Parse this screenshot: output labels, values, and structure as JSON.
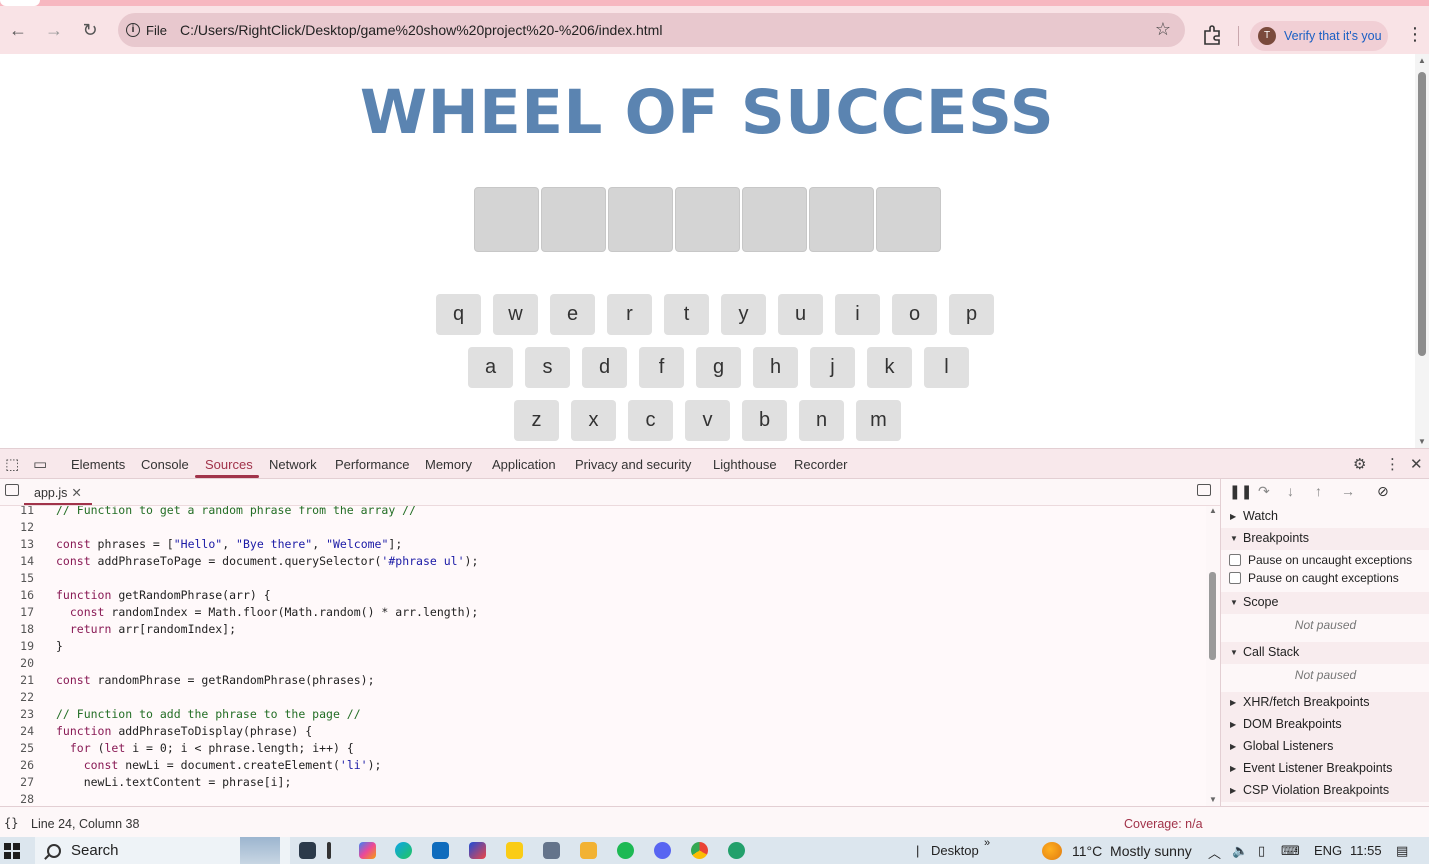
{
  "browser": {
    "site_chip_label": "File",
    "url": "C:/Users/RightClick/Desktop/game%20show%20project%20-%206/index.html",
    "profile_initial": "T",
    "profile_label": "Verify that it's you"
  },
  "game": {
    "title": "WHEEL OF SUCCESS",
    "phrase_tile_count": 7,
    "keyboard_rows": [
      [
        "q",
        "w",
        "e",
        "r",
        "t",
        "y",
        "u",
        "i",
        "o",
        "p"
      ],
      [
        "a",
        "s",
        "d",
        "f",
        "g",
        "h",
        "j",
        "k",
        "l"
      ],
      [
        "z",
        "x",
        "c",
        "v",
        "b",
        "n",
        "m"
      ]
    ]
  },
  "devtools": {
    "tabs": [
      "Elements",
      "Console",
      "Sources",
      "Network",
      "Performance",
      "Memory",
      "Application",
      "Privacy and security",
      "Lighthouse",
      "Recorder"
    ],
    "active_tab": "Sources",
    "open_file": "app.js",
    "code_lines": [
      {
        "n": "11",
        "text": "// Function to get a random phrase from the array //"
      },
      {
        "n": "12",
        "text": ""
      },
      {
        "n": "13",
        "text": "const phrases = [\"Hello\", \"Bye there\", \"Welcome\"];"
      },
      {
        "n": "14",
        "text": "const addPhraseToPage = document.querySelector('#phrase ul');"
      },
      {
        "n": "15",
        "text": ""
      },
      {
        "n": "16",
        "text": "function getRandomPhrase(arr) {"
      },
      {
        "n": "17",
        "text": "  const randomIndex = Math.floor(Math.random() * arr.length);"
      },
      {
        "n": "18",
        "text": "  return arr[randomIndex];"
      },
      {
        "n": "19",
        "text": "}"
      },
      {
        "n": "20",
        "text": ""
      },
      {
        "n": "21",
        "text": "const randomPhrase = getRandomPhrase(phrases);"
      },
      {
        "n": "22",
        "text": ""
      },
      {
        "n": "23",
        "text": "// Function to add the phrase to the page //"
      },
      {
        "n": "24",
        "text": "function addPhraseToDisplay(phrase) {"
      },
      {
        "n": "25",
        "text": "  for (let i = 0; i < phrase.length; i++) {"
      },
      {
        "n": "26",
        "text": "    const newLi = document.createElement('li');"
      },
      {
        "n": "27",
        "text": "    newLi.textContent = phrase[i];"
      },
      {
        "n": "28",
        "text": ""
      }
    ],
    "sidebar": {
      "watch": "Watch",
      "breakpoints": "Breakpoints",
      "pause_uncaught": "Pause on uncaught exceptions",
      "pause_caught": "Pause on caught exceptions",
      "scope": "Scope",
      "scope_status": "Not paused",
      "call_stack": "Call Stack",
      "call_stack_status": "Not paused",
      "xhr": "XHR/fetch Breakpoints",
      "dom": "DOM Breakpoints",
      "global": "Global Listeners",
      "event": "Event Listener Breakpoints",
      "csp": "CSP Violation Breakpoints"
    },
    "status": {
      "braces": "{}",
      "cursor": "Line 24, Column 38",
      "coverage": "Coverage: n/a"
    }
  },
  "taskbar": {
    "search": "Search",
    "desktop": "Desktop",
    "weather_temp": "11°C",
    "weather_desc": "Mostly sunny",
    "lang": "ENG",
    "time": "11:55"
  },
  "colors": {
    "title_blue": "#5b84b1",
    "tile_gray": "#d4d4d4",
    "key_gray": "#e0e0e0",
    "devtools_accent": "#a1334a"
  }
}
